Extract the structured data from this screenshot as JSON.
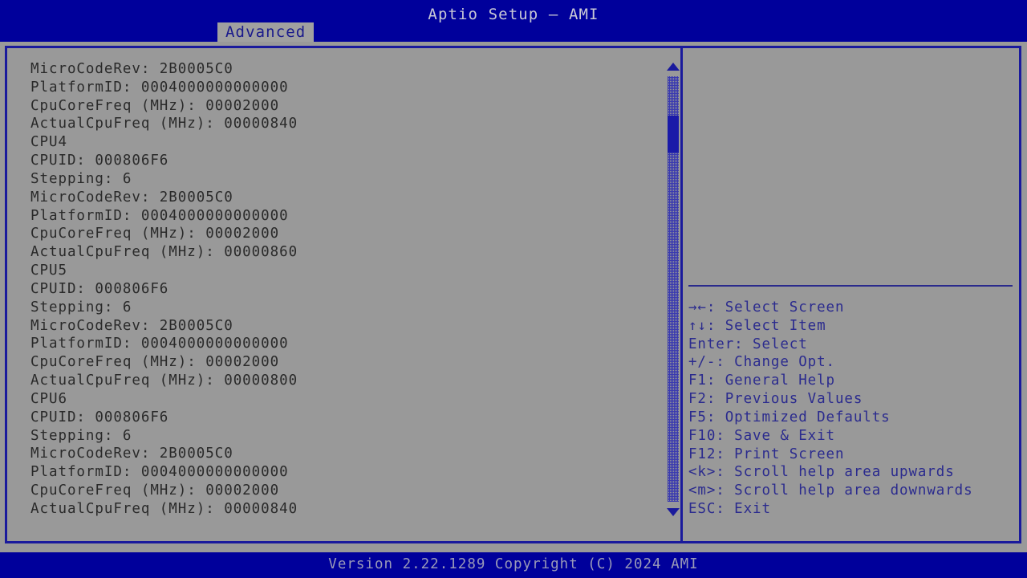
{
  "header": {
    "title": "Aptio Setup – AMI",
    "tabs": [
      {
        "label": "Advanced",
        "active": true
      }
    ]
  },
  "main": {
    "info_lines": [
      "MicroCodeRev: 2B0005C0",
      "PlatformID: 0004000000000000",
      "CpuCoreFreq (MHz): 00002000",
      "ActualCpuFreq (MHz): 00000840",
      "CPU4",
      "CPUID: 000806F6",
      "Stepping: 6",
      "MicroCodeRev: 2B0005C0",
      "PlatformID: 0004000000000000",
      "CpuCoreFreq (MHz): 00002000",
      "ActualCpuFreq (MHz): 00000860",
      "CPU5",
      "CPUID: 000806F6",
      "Stepping: 6",
      "MicroCodeRev: 2B0005C0",
      "PlatformID: 0004000000000000",
      "CpuCoreFreq (MHz): 00002000",
      "ActualCpuFreq (MHz): 00000800",
      "CPU6",
      "CPUID: 000806F6",
      "Stepping: 6",
      "MicroCodeRev: 2B0005C0",
      "PlatformID: 0004000000000000",
      "CpuCoreFreq (MHz): 00002000",
      "ActualCpuFreq (MHz): 00000840"
    ]
  },
  "scrollbar": {
    "up_arrow": "scroll-up-arrow",
    "down_arrow": "scroll-down-arrow"
  },
  "help": {
    "lines": [
      "→←: Select Screen",
      "↑↓: Select Item",
      "Enter: Select",
      "+/-: Change Opt.",
      "F1: General Help",
      "F2: Previous Values",
      "F5: Optimized Defaults",
      "F10: Save & Exit",
      "F12: Print Screen",
      "<k>: Scroll help area upwards",
      "<m>: Scroll help area downwards",
      "ESC: Exit"
    ]
  },
  "footer": {
    "version_text": "Version 2.22.1289 Copyright (C) 2024 AMI"
  },
  "colors": {
    "blue": "#00009b",
    "gray": "#999999",
    "border_blue": "#1a1a9c",
    "help_text": "#2b2b8e",
    "info_text": "#2a2a2a",
    "title_text": "#c9c9d6",
    "footer_text": "#9a9ab8",
    "tab_active_bg": "#a0a0a0"
  }
}
